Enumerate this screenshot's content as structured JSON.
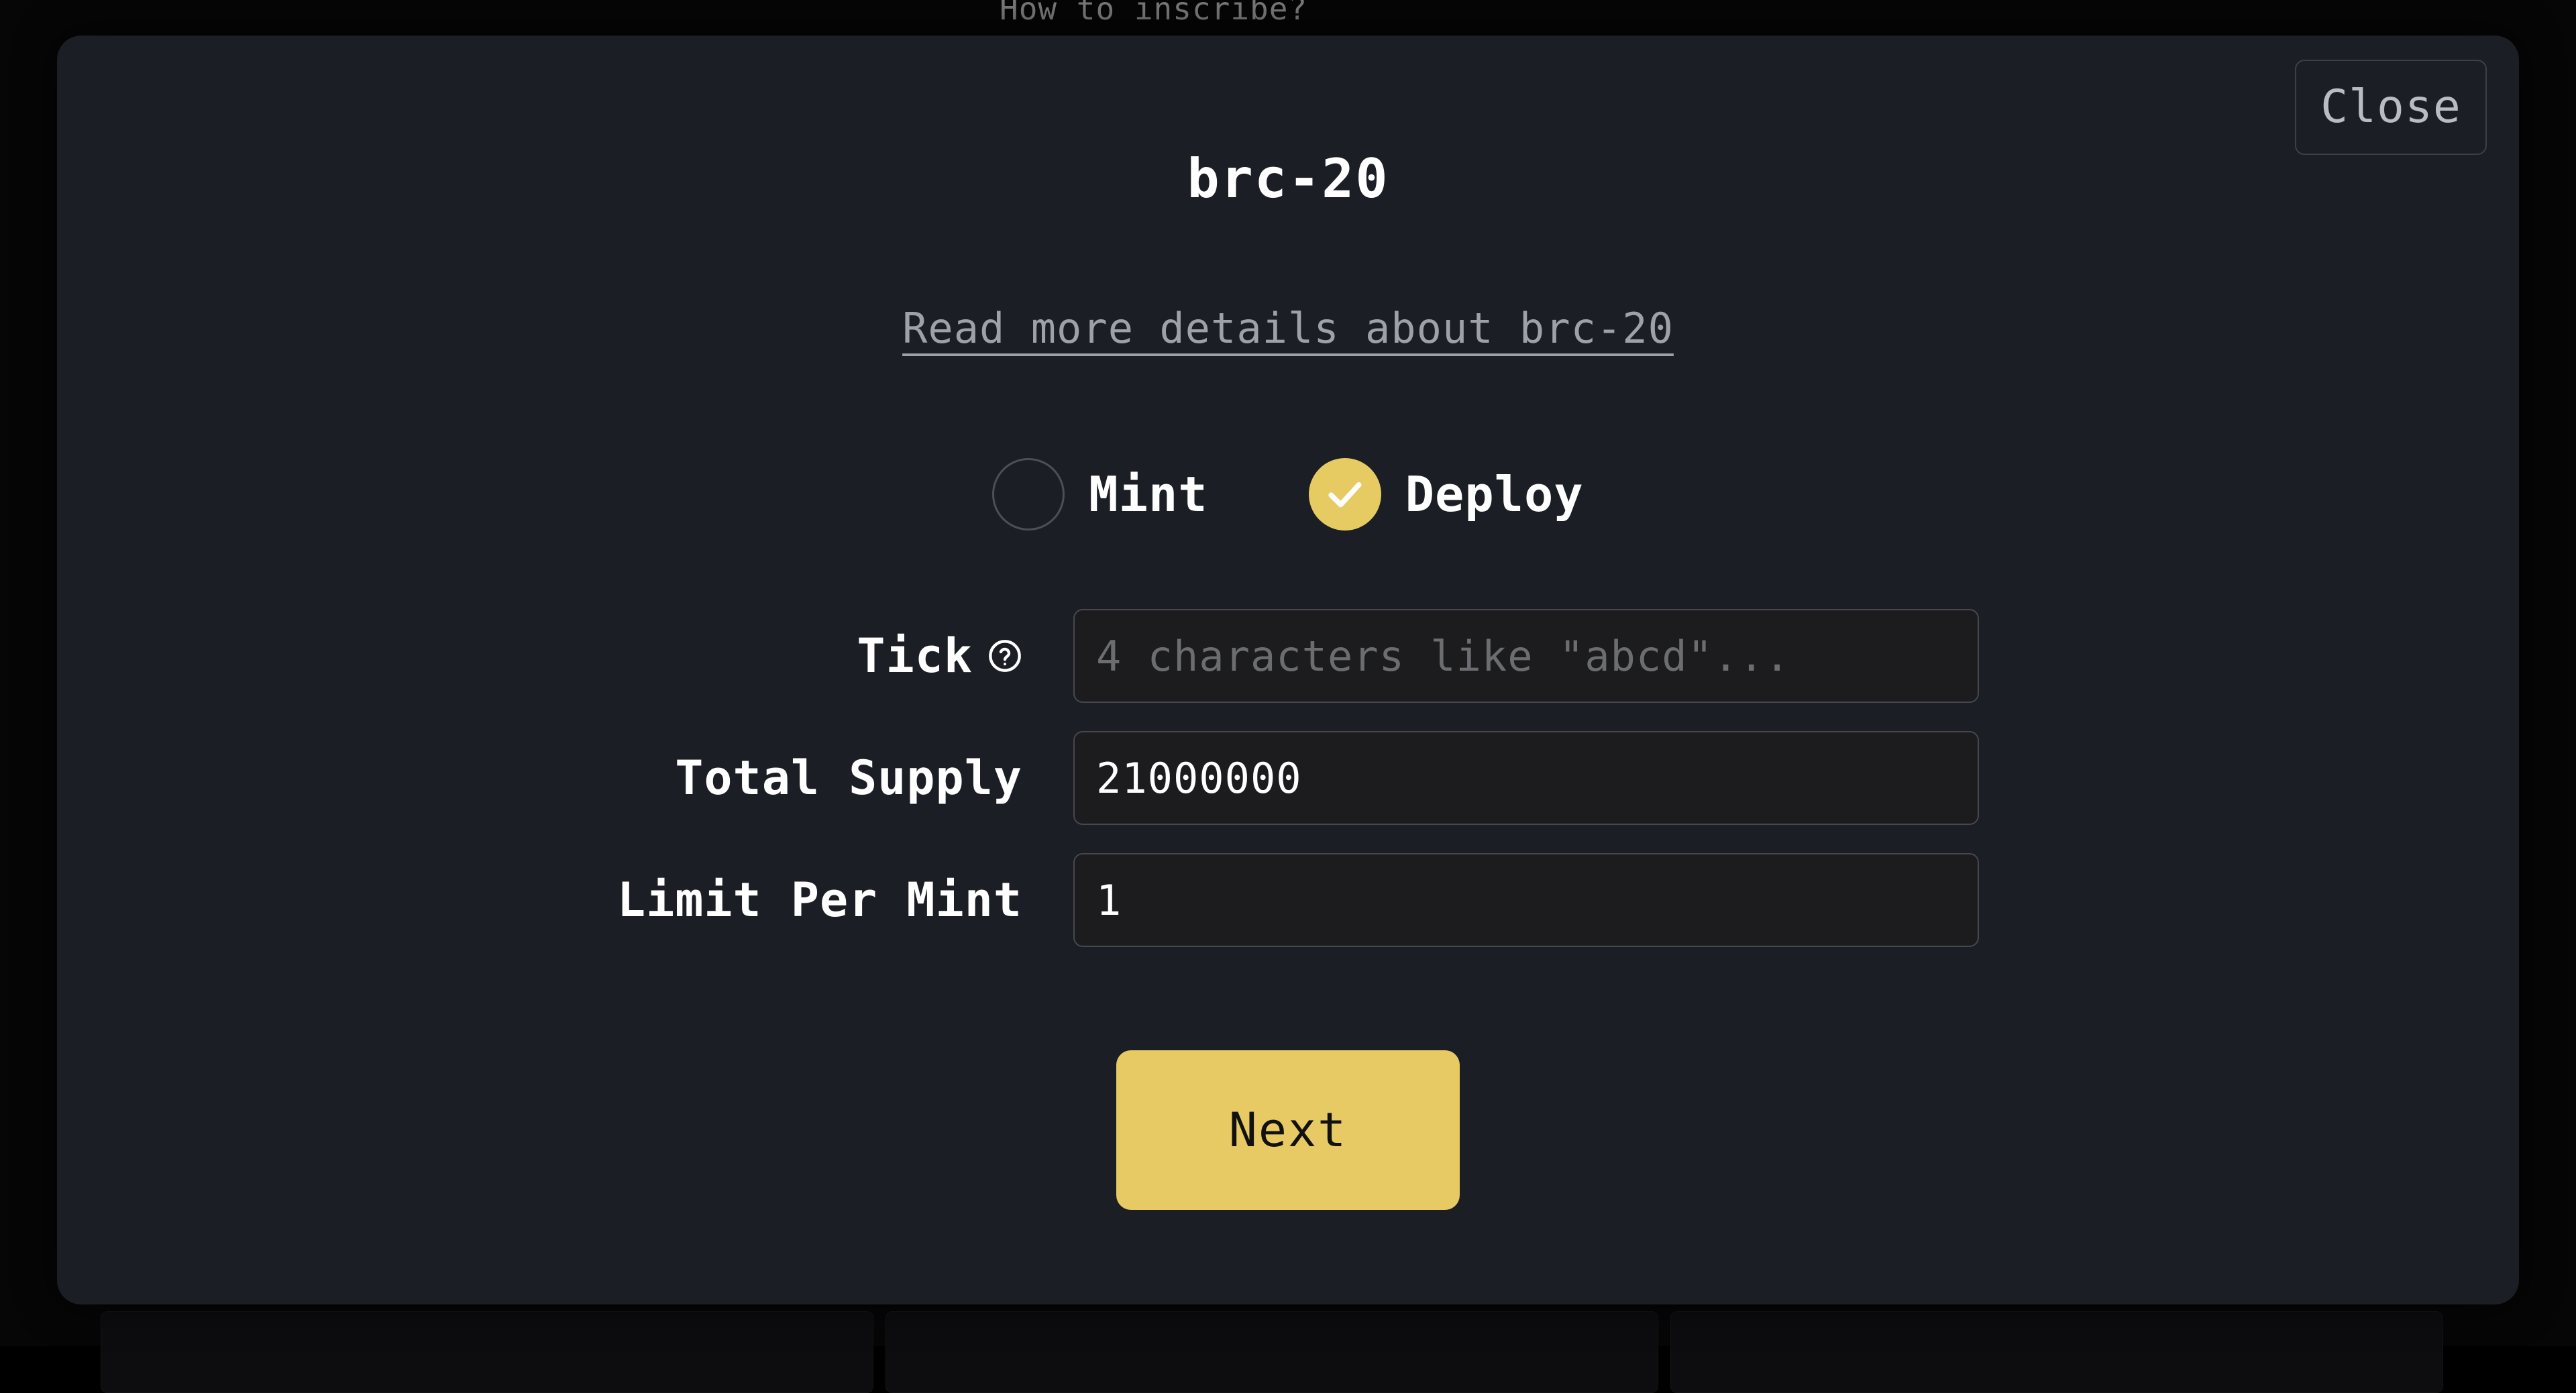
{
  "colors": {
    "modal_background": "#1b1e24",
    "page_backdrop": "#060607",
    "accent_gold": "#e6cb63",
    "next_button": "#e8ca64",
    "input_background": "#1c1c1e",
    "input_border": "#46484d",
    "muted_text": "#9ea1a6",
    "placeholder_text": "#6b6d70"
  },
  "background": {
    "cut_off_heading": "How to inscribe?"
  },
  "modal": {
    "title": "brc-20",
    "close_label": "Close",
    "details_link": "Read more details about brc-20",
    "mode_options": [
      {
        "label": "Mint",
        "selected": false
      },
      {
        "label": "Deploy",
        "selected": true
      }
    ],
    "fields": [
      {
        "label": "Tick",
        "has_help_icon": true,
        "value": "",
        "placeholder": "4 characters like \"abcd\"..."
      },
      {
        "label": "Total Supply",
        "has_help_icon": false,
        "value": "21000000",
        "placeholder": ""
      },
      {
        "label": "Limit Per Mint",
        "has_help_icon": false,
        "value": "1",
        "placeholder": ""
      }
    ],
    "next_label": "Next"
  }
}
